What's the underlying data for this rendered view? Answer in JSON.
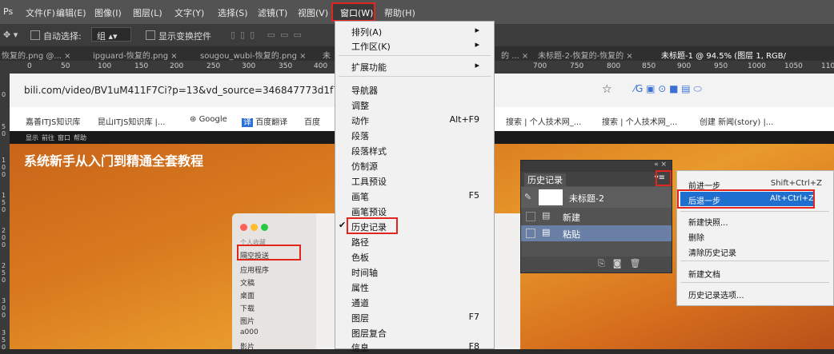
{
  "menubar": {
    "items": [
      "文件(F)",
      "编辑(E)",
      "图像(I)",
      "图层(L)",
      "文字(Y)",
      "选择(S)",
      "滤镜(T)",
      "视图(V)",
      "窗口(W)",
      "帮助(H)"
    ]
  },
  "options": {
    "auto_select": "自动选择:",
    "group": "组",
    "show_transform": "显示变换控件"
  },
  "tabs": [
    "恢复的.png @... ×",
    "ipguard-恢复的.png ×",
    "sougou_wubi-恢复的.png ×",
    "未",
    "的 ... ×",
    "未标题-2-恢复的-恢复的 ×",
    "未标题-1 @ 94.5% (图层 1, RGB/"
  ],
  "ruler": [
    "0",
    "50",
    "100",
    "150",
    "200",
    "250",
    "300",
    "350",
    "400",
    "700",
    "750",
    "800",
    "850",
    "900",
    "950",
    "1000",
    "1050",
    "110"
  ],
  "vruler": [
    "0",
    "5",
    "0",
    "1",
    "0",
    "0",
    "1",
    "5",
    "0",
    "2",
    "0",
    "0",
    "2",
    "5",
    "0",
    "3",
    "0",
    "0",
    "3",
    "5",
    "0"
  ],
  "browser": {
    "url": "bili.com/video/BV1uM411F7Ci?p=13&vd_source=346847773d1f749",
    "bookmarks": [
      "嘉善ITJS知识库",
      "昆山ITJS知识库 |...",
      "Google",
      "百度翻译",
      "百度",
      "搜索 | 个人技术网_...",
      "搜索 | 个人技术网_...",
      "创建 新闻(story) |..."
    ],
    "video_menu": [
      "显示",
      "前往",
      "窗口",
      "帮助"
    ],
    "video_title": "系统新手从入门到精通全套教程"
  },
  "finder": {
    "section": "个人收藏",
    "items": [
      "隔空投送",
      "应用程序",
      "文稿",
      "桌面",
      "下载",
      "图片",
      "a000",
      "影片"
    ]
  },
  "window_menu": {
    "items": [
      {
        "label": "排列(A)",
        "shortcut": "",
        "submenu": true
      },
      {
        "label": "工作区(K)",
        "shortcut": "",
        "submenu": true
      },
      {
        "label": "扩展功能",
        "shortcut": "",
        "submenu": true
      },
      {
        "label": "导航器",
        "shortcut": ""
      },
      {
        "label": "调整",
        "shortcut": ""
      },
      {
        "label": "动作",
        "shortcut": "Alt+F9"
      },
      {
        "label": "段落",
        "shortcut": ""
      },
      {
        "label": "段落样式",
        "shortcut": ""
      },
      {
        "label": "仿制源",
        "shortcut": ""
      },
      {
        "label": "工具预设",
        "shortcut": ""
      },
      {
        "label": "画笔",
        "shortcut": "F5"
      },
      {
        "label": "画笔预设",
        "shortcut": ""
      },
      {
        "label": "历史记录",
        "shortcut": "",
        "checked": true
      },
      {
        "label": "路径",
        "shortcut": ""
      },
      {
        "label": "色板",
        "shortcut": ""
      },
      {
        "label": "时间轴",
        "shortcut": ""
      },
      {
        "label": "属性",
        "shortcut": ""
      },
      {
        "label": "通道",
        "shortcut": ""
      },
      {
        "label": "图层",
        "shortcut": "F7"
      },
      {
        "label": "图层复合",
        "shortcut": ""
      },
      {
        "label": "信息",
        "shortcut": "F8"
      }
    ]
  },
  "history_panel": {
    "tab": "历史记录",
    "snapshot": "未标题-2",
    "steps": [
      "新建",
      "粘贴"
    ]
  },
  "flyout": {
    "items": [
      {
        "label": "前进一步",
        "shortcut": "Shift+Ctrl+Z"
      },
      {
        "label": "后退一步",
        "shortcut": "Alt+Ctrl+Z"
      },
      {
        "label": "新建快照..."
      },
      {
        "label": "删除"
      },
      {
        "label": "清除历史记录"
      },
      {
        "label": "新建文档"
      },
      {
        "label": "历史记录选项..."
      }
    ]
  },
  "colors": {
    "highlight_red": "#e0261f",
    "menu_bg": "#f1f1f1",
    "flyout_selected": "#1e6fd0"
  }
}
